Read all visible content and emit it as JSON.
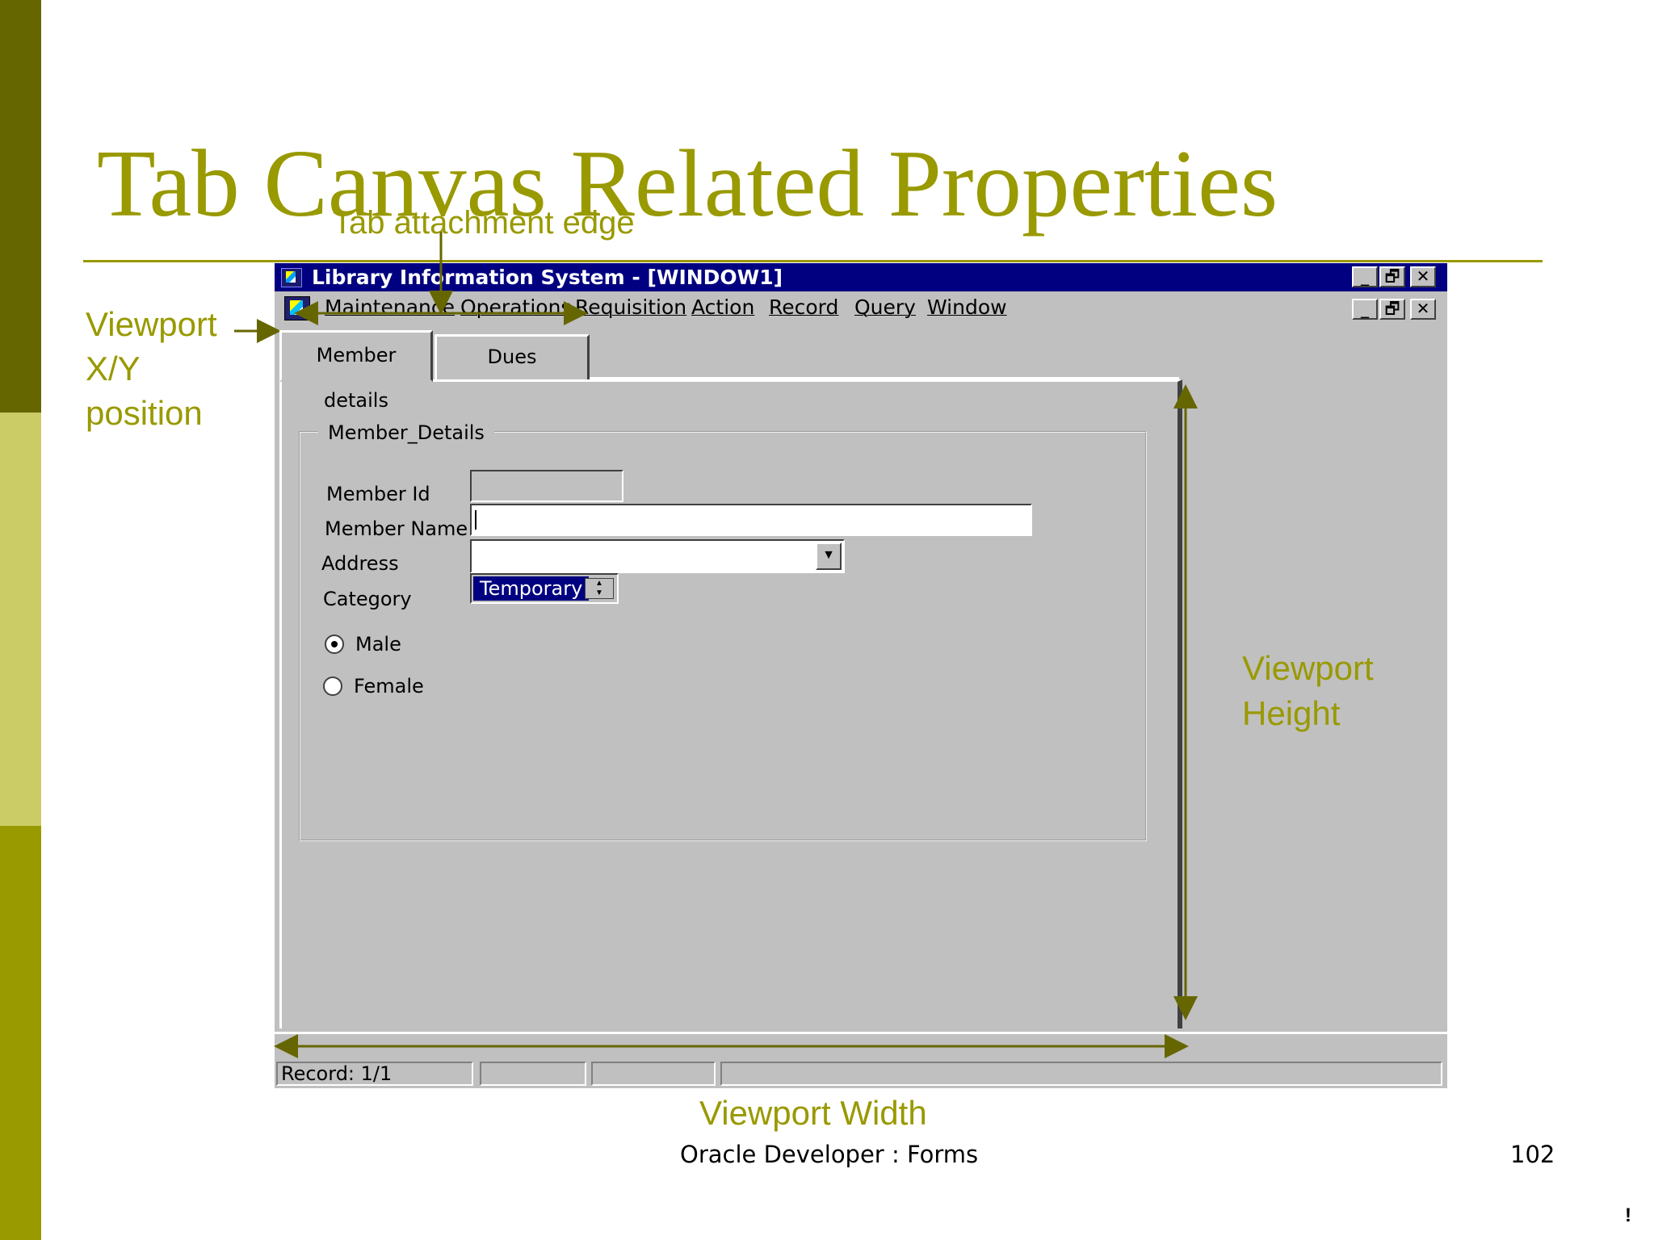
{
  "slide": {
    "title": "Tab Canvas Related Properties",
    "footer": "Oracle Developer : Forms",
    "page_number": "102",
    "corner_mark": "!",
    "accent_color": "#999900",
    "annotations": {
      "viewport_xy": "Viewport X/Y position",
      "tab_attachment_edge": "Tab attachment edge",
      "viewport_height": "Viewport Height",
      "viewport_width": "Viewport Width"
    }
  },
  "window": {
    "title": "Library Information System - [WINDOW1]",
    "title_bar_color": "#000080",
    "buttons": {
      "minimize": "_",
      "restore": "🗗",
      "close": "✕"
    },
    "menu": [
      "Maintenance",
      "Operations",
      "Requisition",
      "Action",
      "Record",
      "Query",
      "Window"
    ],
    "tabs": [
      "Member details",
      "Dues"
    ],
    "frame_title": "Member_Details",
    "fields": {
      "member_id_label": "Member Id",
      "member_name_label": "Member Name",
      "address_label": "Address",
      "category_label": "Category",
      "category_value": "Temporary"
    },
    "radios": {
      "male": "Male",
      "female": "Female",
      "selected": "Male"
    },
    "status": {
      "record": "Record: 1/1"
    }
  }
}
